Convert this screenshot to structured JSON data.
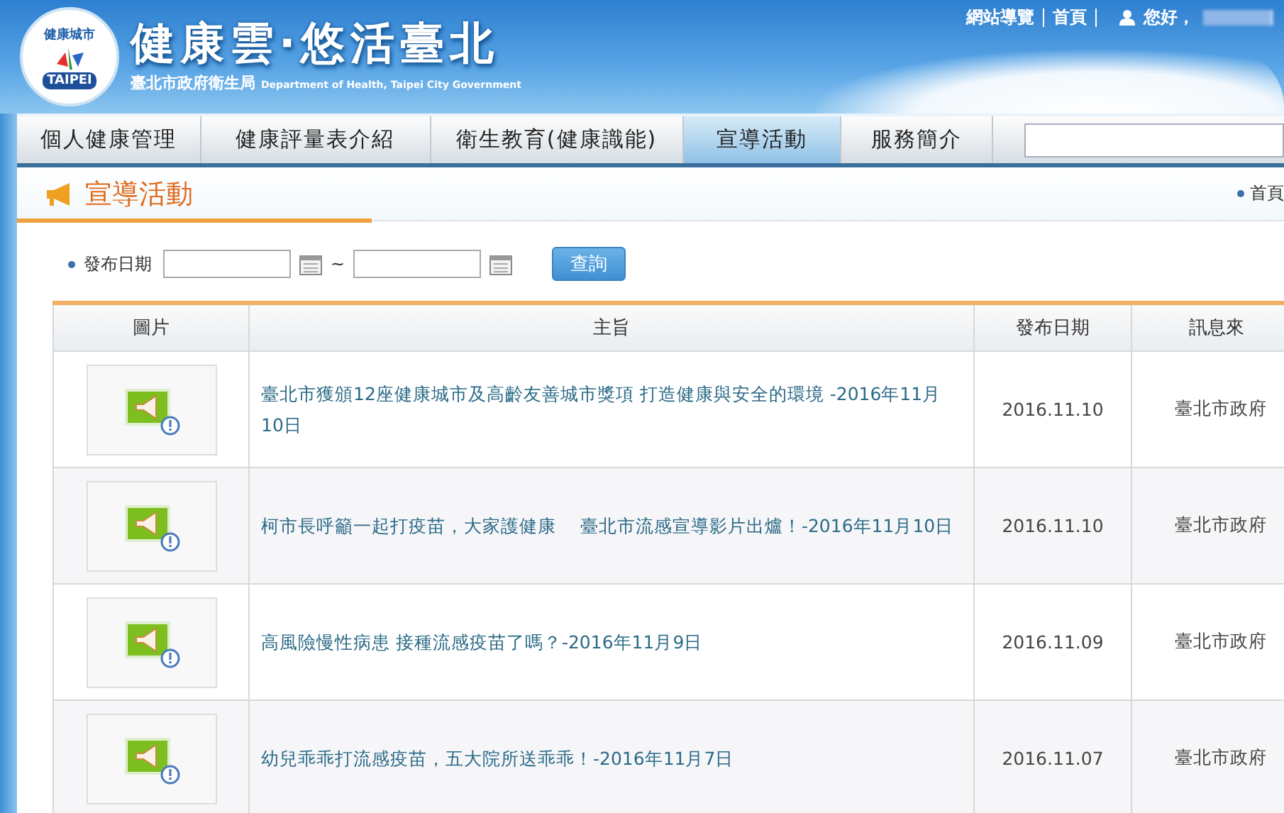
{
  "header": {
    "logo": {
      "arc_text": "健康城市",
      "badge_text": "TAIPEI"
    },
    "title": "健康雲‧悠活臺北",
    "agency": "臺北市政府衛生局",
    "agency_en": "Department of Health, Taipei City Government",
    "top_links": [
      "網站導覽",
      "首頁"
    ],
    "greeting": "您好，"
  },
  "nav": {
    "tabs": [
      {
        "label": "個人健康管理",
        "selected": false
      },
      {
        "label": "健康評量表介紹",
        "selected": false
      },
      {
        "label": "衛生教育(健康識能)",
        "selected": false
      },
      {
        "label": "宣導活動",
        "selected": true
      },
      {
        "label": "服務簡介",
        "selected": false
      }
    ]
  },
  "page_title": "宣導活動",
  "breadcrumb": "首頁",
  "filter": {
    "label": "發布日期",
    "separator": "~",
    "button": "查詢"
  },
  "table": {
    "columns": [
      "圖片",
      "主旨",
      "發布日期",
      "訊息來"
    ],
    "rows": [
      {
        "subject": "臺北市獲頒12座健康城市及高齡友善城市獎項 打造健康與安全的環境 -2016年11月10日",
        "date": "2016.11.10",
        "source": "臺北市政府"
      },
      {
        "subject": "柯市長呼籲一起打疫苗，大家護健康　 臺北市流感宣導影片出爐！-2016年11月10日",
        "date": "2016.11.10",
        "source": "臺北市政府"
      },
      {
        "subject": "高風險慢性病患 接種流感疫苗了嗎？-2016年11月9日",
        "date": "2016.11.09",
        "source": "臺北市政府"
      },
      {
        "subject": "幼兒乖乖打流感疫苗，五大院所送乖乖！-2016年11月7日",
        "date": "2016.11.07",
        "source": "臺北市政府"
      }
    ]
  }
}
